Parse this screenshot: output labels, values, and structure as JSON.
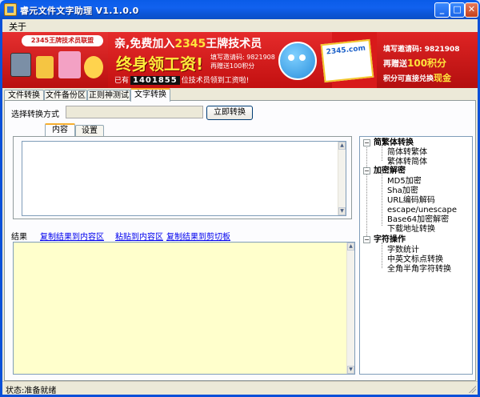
{
  "window": {
    "title": "睿元文件文字助理 V1.1.0.0",
    "controls": {
      "minimize": "_",
      "maximize": "□",
      "close": "✕"
    }
  },
  "menu": {
    "items": [
      "关于"
    ]
  },
  "banner": {
    "logo_text": "2345王牌技术员联盟",
    "slogan_prefix": "亲,免费加入",
    "slogan_brand": "2345",
    "slogan_suffix": "王牌技术员",
    "slogan_main": "终身领工资!",
    "small_invite_line1": "填写邀请码: 9821908",
    "small_invite_line2": "再赠送100积分",
    "counter_prefix": "已有",
    "counter_value": "1401855",
    "counter_suffix": "位技术员领到工资啦!",
    "site_box_text": "2345.com",
    "right_line1": "填写邀请码: 9821908",
    "right_line2_prefix": "再赠送",
    "right_line2_highlight": "100积分",
    "right_line3_prefix": "积分可直接兑换",
    "right_line3_highlight": "现金"
  },
  "tabs": [
    {
      "label": "文件转换",
      "active": false
    },
    {
      "label": "文件备份区",
      "active": false
    },
    {
      "label": "正则神测试",
      "active": false
    },
    {
      "label": "文字转换",
      "active": true
    }
  ],
  "convert": {
    "mode_label": "选择转换方式",
    "mode_value": "",
    "convert_button": "立即转换"
  },
  "subtabs": [
    {
      "label": "内容",
      "active": true
    },
    {
      "label": "设置",
      "active": false
    }
  ],
  "result": {
    "label": "结果",
    "links": [
      "复制结果到内容区",
      "粘贴到内容区",
      "复制结果到剪切板"
    ]
  },
  "tree": {
    "categories": [
      {
        "label": "简繁体转换",
        "expander": "−",
        "items": [
          "简体转繁体",
          "繁体转简体"
        ]
      },
      {
        "label": "加密解密",
        "expander": "−",
        "items": [
          "MD5加密",
          "Sha加密",
          "URL编码解码",
          "escape/unescape",
          "Base64加密解密",
          "下载地址转换"
        ]
      },
      {
        "label": "字符操作",
        "expander": "−",
        "items": [
          "字数统计",
          "中英文标点转换",
          "全角半角字符转换"
        ]
      }
    ]
  },
  "status": {
    "text": "状态:准备就绪"
  },
  "colors": {
    "title_bar": "#0a5ce8",
    "output_bg": "#ffffcc",
    "link": "#0000ee",
    "banner_red": "#d81a1a"
  }
}
